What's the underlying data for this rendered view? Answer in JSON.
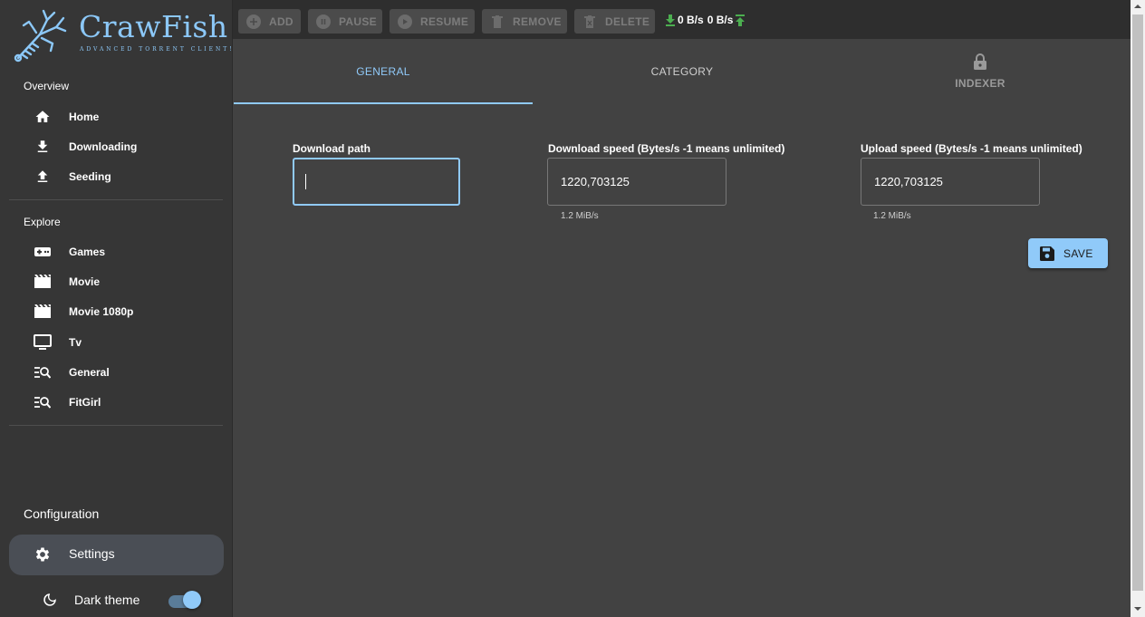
{
  "app": {
    "title": "CrawFish",
    "subtitle": "ADVANCED TORRENT CLIENT!"
  },
  "sidebar": {
    "overview_title": "Overview",
    "overview_items": [
      {
        "label": "Home",
        "icon": "home-icon"
      },
      {
        "label": "Downloading",
        "icon": "download-icon"
      },
      {
        "label": "Seeding",
        "icon": "upload-icon"
      }
    ],
    "explore_title": "Explore",
    "explore_items": [
      {
        "label": "Games",
        "icon": "gamepad-icon"
      },
      {
        "label": "Movie",
        "icon": "movie-icon"
      },
      {
        "label": "Movie 1080p",
        "icon": "movie-icon"
      },
      {
        "label": "Tv",
        "icon": "tv-icon"
      },
      {
        "label": "General",
        "icon": "search-list-icon"
      },
      {
        "label": "FitGirl",
        "icon": "search-list-icon"
      }
    ],
    "config_title": "Configuration",
    "settings_label": "Settings",
    "dark_theme_label": "Dark theme",
    "dark_theme_on": true
  },
  "toolbar": {
    "add": "ADD",
    "pause": "PAUSE",
    "resume": "RESUME",
    "remove": "REMOVE",
    "delete": "DELETE",
    "download_speed": "0 B/s",
    "upload_speed": "0 B/s"
  },
  "tabs": [
    {
      "label": "GENERAL",
      "active": true
    },
    {
      "label": "CATEGORY",
      "active": false
    },
    {
      "label": "INDEXER",
      "locked": true
    }
  ],
  "form": {
    "download_path_label": "Download path",
    "download_path_value": "",
    "download_speed_label": "Download speed (Bytes/s -1 means unlimited)",
    "download_speed_value": "1220,703125",
    "download_speed_helper": "1.2 MiB/s",
    "upload_speed_label": "Upload speed (Bytes/s -1 means unlimited)",
    "upload_speed_value": "1220,703125",
    "upload_speed_helper": "1.2 MiB/s",
    "save_label": "SAVE"
  },
  "colors": {
    "accent": "#90caf9",
    "background": "#424242",
    "sidebar": "#363636",
    "toolbar": "#2e2e2e",
    "speed_arrow": "#4caf50"
  }
}
